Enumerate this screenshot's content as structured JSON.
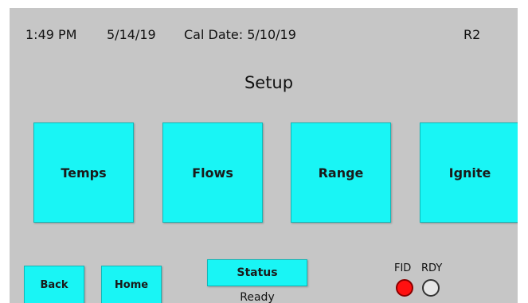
{
  "header": {
    "time": "1:49 PM",
    "date": "5/14/19",
    "cal_date": "Cal Date: 5/10/19",
    "revision": "R2"
  },
  "title": "Setup",
  "menu": {
    "temps": "Temps",
    "flows": "Flows",
    "range": "Range",
    "ignite": "Ignite"
  },
  "nav": {
    "back": "Back",
    "home": "Home"
  },
  "status": {
    "button_label": "Status",
    "value": "Ready"
  },
  "indicators": {
    "fid_label": "FID",
    "rdy_label": "RDY",
    "fid_state": "on",
    "rdy_state": "off",
    "fid_color": "#ff1010",
    "rdy_color": "#e6e6e6"
  },
  "colors": {
    "button": "#19f5f5",
    "background": "#c6c6c6"
  }
}
